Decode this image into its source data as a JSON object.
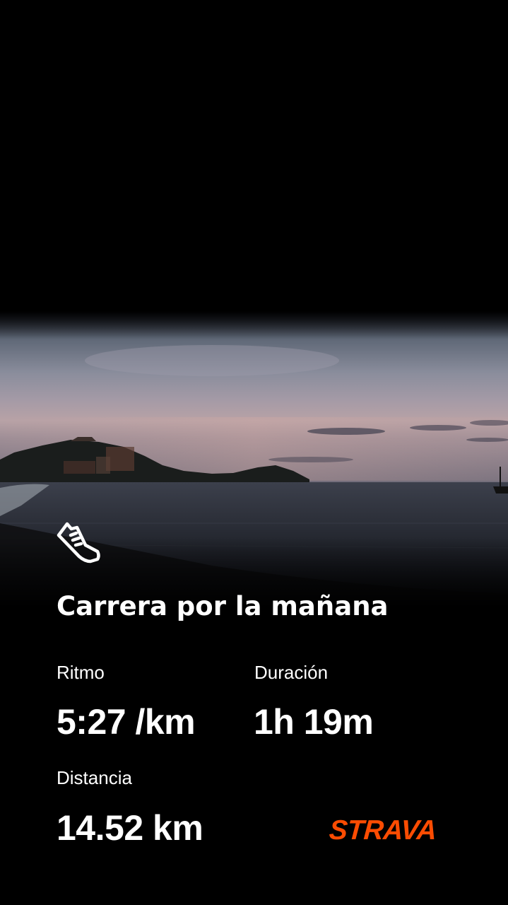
{
  "activity": {
    "title": "Carrera por la mañana",
    "icon": "running-shoe-icon"
  },
  "stats": {
    "pace": {
      "label": "Ritmo",
      "value": "5:27 /km"
    },
    "duration": {
      "label": "Duración",
      "value": "1h 19m"
    },
    "distance": {
      "label": "Distancia",
      "value": "14.52 km"
    }
  },
  "brand": {
    "name": "STRAVA",
    "color": "#FC4C02"
  },
  "colors": {
    "background": "#000000",
    "text": "#FFFFFF"
  }
}
